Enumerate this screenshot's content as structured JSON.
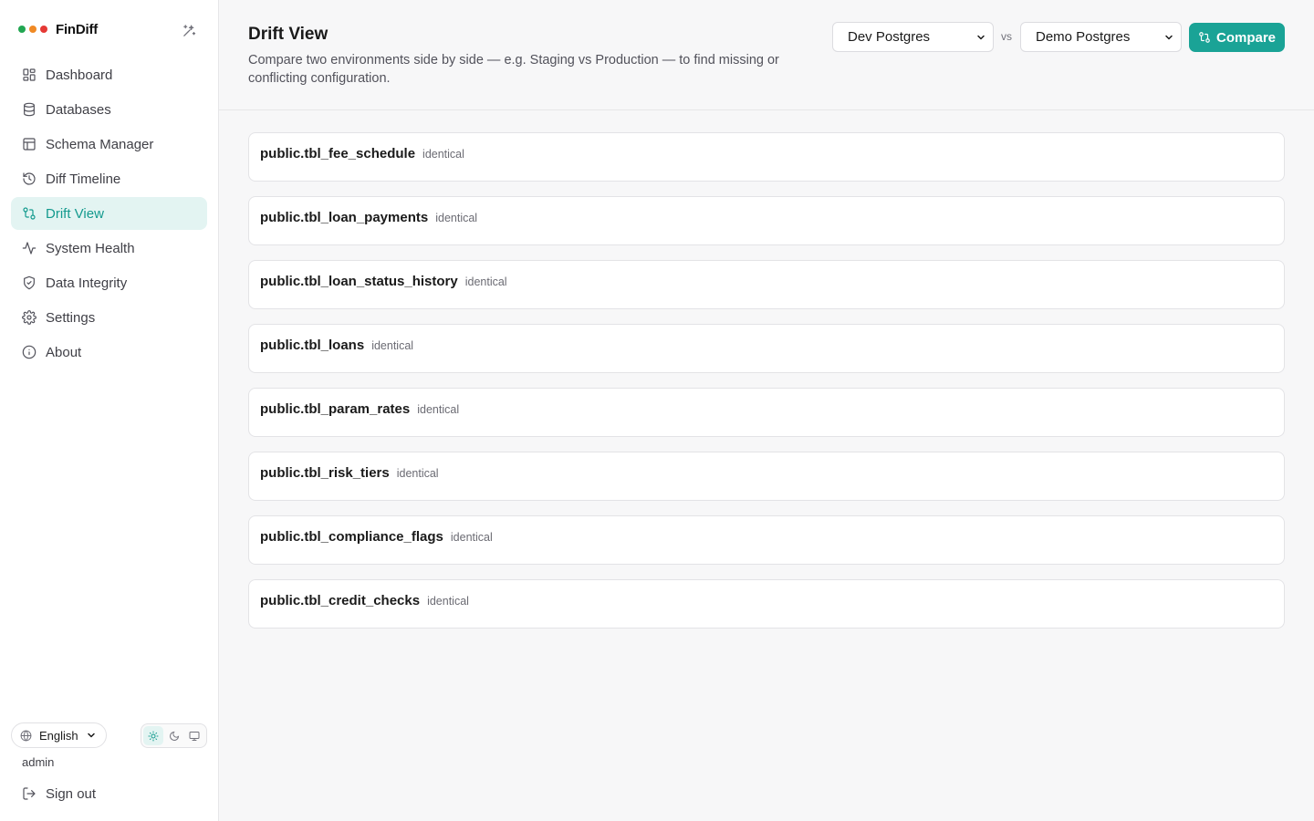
{
  "app": {
    "name": "FinDiff",
    "window_dots": [
      "#22a652",
      "#f08a24",
      "#e53935"
    ]
  },
  "sidebar": {
    "items": [
      {
        "label": "Dashboard",
        "icon": "dashboard-icon",
        "active": false
      },
      {
        "label": "Databases",
        "icon": "database-icon",
        "active": false
      },
      {
        "label": "Schema Manager",
        "icon": "table-icon",
        "active": false
      },
      {
        "label": "Diff Timeline",
        "icon": "history-icon",
        "active": false
      },
      {
        "label": "Drift View",
        "icon": "git-compare-icon",
        "active": true
      },
      {
        "label": "System Health",
        "icon": "activity-icon",
        "active": false
      },
      {
        "label": "Data Integrity",
        "icon": "shield-check-icon",
        "active": false
      },
      {
        "label": "Settings",
        "icon": "gear-icon",
        "active": false
      },
      {
        "label": "About",
        "icon": "info-icon",
        "active": false
      }
    ],
    "language": "English",
    "user": "admin",
    "sign_out": "Sign out"
  },
  "header": {
    "title": "Drift View",
    "description": "Compare two environments side by side — e.g. Staging vs Production — to find missing or conflicting configuration.",
    "env_a": "Dev Postgres",
    "vs": "vs",
    "env_b": "Demo Postgres",
    "compare_label": "Compare"
  },
  "tables": [
    {
      "name": "public.tbl_fee_schedule",
      "status": "identical"
    },
    {
      "name": "public.tbl_loan_payments",
      "status": "identical"
    },
    {
      "name": "public.tbl_loan_status_history",
      "status": "identical"
    },
    {
      "name": "public.tbl_loans",
      "status": "identical"
    },
    {
      "name": "public.tbl_param_rates",
      "status": "identical"
    },
    {
      "name": "public.tbl_risk_tiers",
      "status": "identical"
    },
    {
      "name": "public.tbl_compliance_flags",
      "status": "identical"
    },
    {
      "name": "public.tbl_credit_checks",
      "status": "identical"
    }
  ],
  "colors": {
    "accent": "#1aa396",
    "active_bg": "#e3f4f2"
  }
}
